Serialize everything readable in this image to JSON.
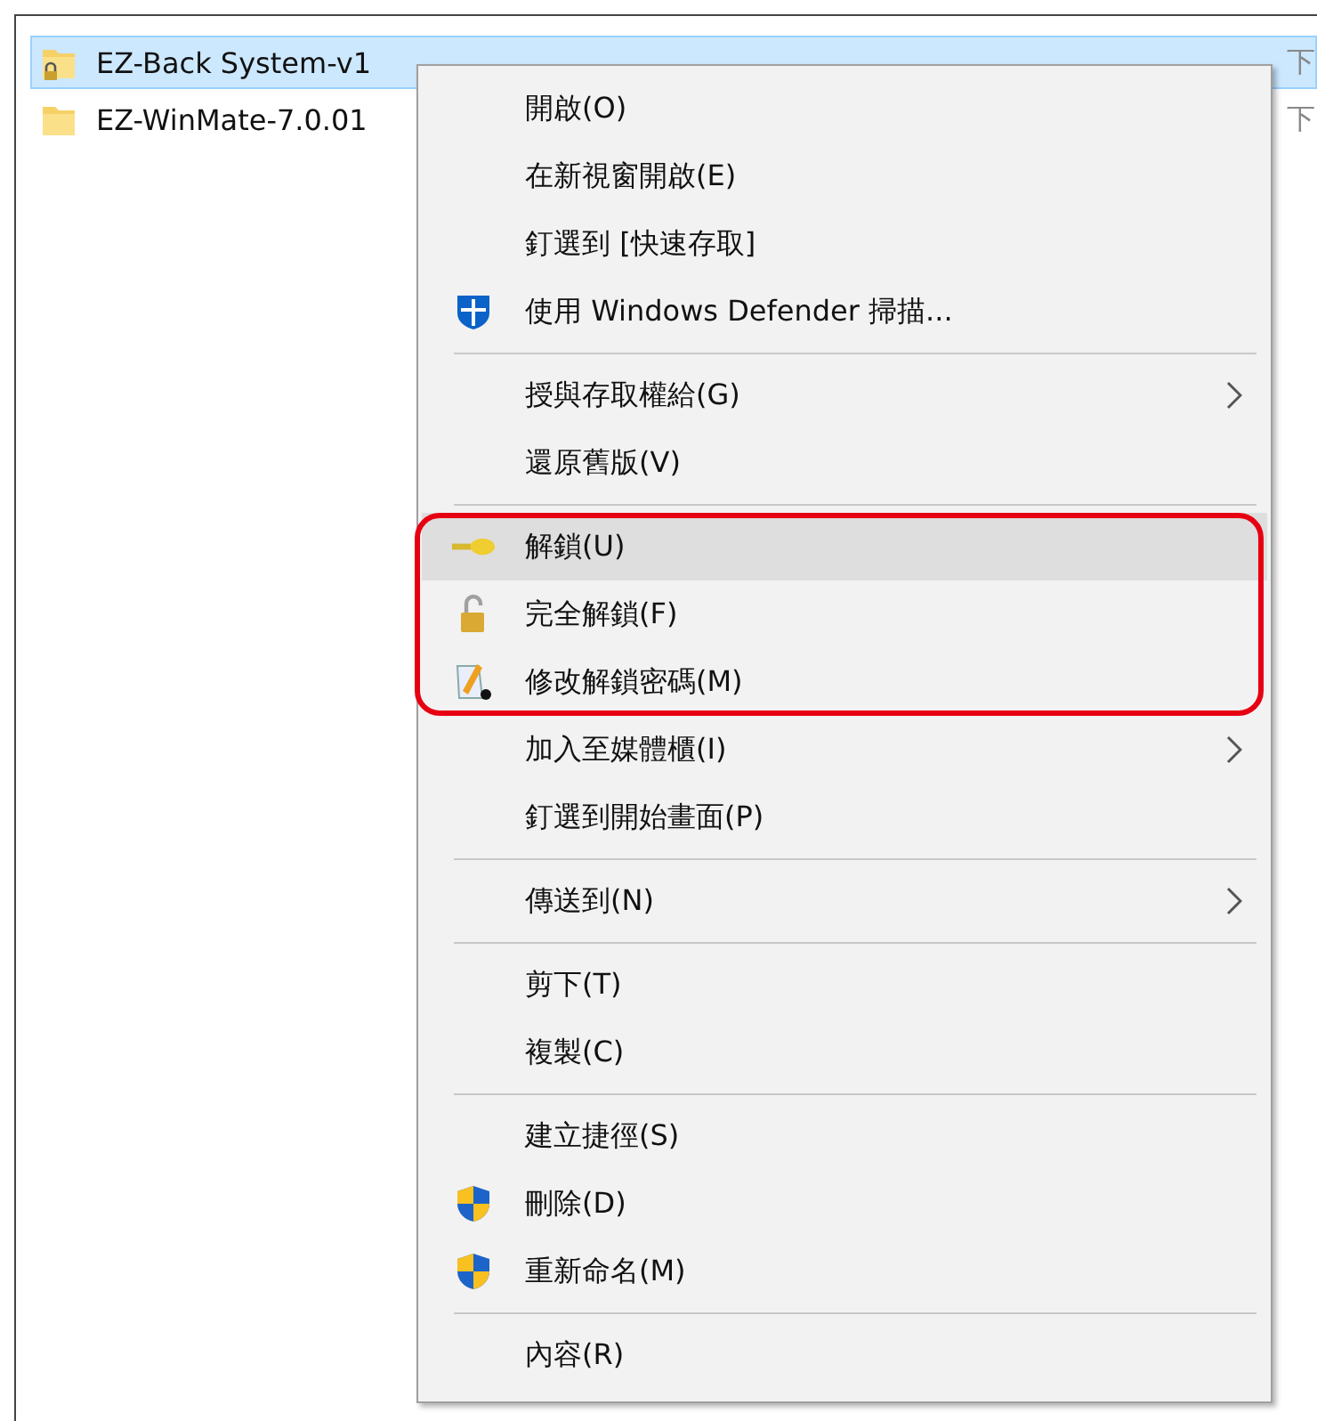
{
  "files": [
    {
      "name": "EZ-Back System-v1",
      "type_hint": "下",
      "selected": true,
      "locked": true
    },
    {
      "name": "EZ-WinMate-7.0.01",
      "type_hint": "下",
      "selected": false,
      "locked": false
    }
  ],
  "context_menu": {
    "sections": [
      {
        "items": [
          {
            "label": "開啟(O)",
            "kind": "plain",
            "selected": false,
            "submenu": false,
            "outlined": false
          },
          {
            "label": "在新視窗開啟(E)",
            "kind": "plain",
            "selected": false,
            "submenu": false,
            "outlined": false
          },
          {
            "label": "釘選到 [快速存取]",
            "kind": "plain",
            "selected": false,
            "submenu": false,
            "outlined": false
          },
          {
            "label": "使用 Windows Defender 掃描...",
            "kind": "defender",
            "selected": false,
            "submenu": false,
            "outlined": false
          }
        ]
      },
      {
        "items": [
          {
            "label": "授與存取權給(G)",
            "kind": "plain",
            "selected": false,
            "submenu": true,
            "outlined": false
          },
          {
            "label": "還原舊版(V)",
            "kind": "plain",
            "selected": false,
            "submenu": false,
            "outlined": false
          }
        ]
      },
      {
        "items": [
          {
            "label": "解鎖(U)",
            "kind": "key",
            "selected": true,
            "submenu": false,
            "outlined": true
          },
          {
            "label": "完全解鎖(F)",
            "kind": "padlock",
            "selected": false,
            "submenu": false,
            "outlined": true
          },
          {
            "label": "修改解鎖密碼(M)",
            "kind": "pen",
            "selected": false,
            "submenu": false,
            "outlined": true
          },
          {
            "label": "加入至媒體櫃(I)",
            "kind": "plain",
            "selected": false,
            "submenu": true,
            "outlined": false
          },
          {
            "label": "釘選到開始畫面(P)",
            "kind": "plain",
            "selected": false,
            "submenu": false,
            "outlined": false
          }
        ]
      },
      {
        "items": [
          {
            "label": "傳送到(N)",
            "kind": "plain",
            "selected": false,
            "submenu": true,
            "outlined": false
          }
        ]
      },
      {
        "items": [
          {
            "label": "剪下(T)",
            "kind": "plain",
            "selected": false,
            "submenu": false,
            "outlined": false
          },
          {
            "label": "複製(C)",
            "kind": "plain",
            "selected": false,
            "submenu": false,
            "outlined": false
          }
        ]
      },
      {
        "items": [
          {
            "label": "建立捷徑(S)",
            "kind": "plain",
            "selected": false,
            "submenu": false,
            "outlined": false
          },
          {
            "label": "刪除(D)",
            "kind": "shield",
            "selected": false,
            "submenu": false,
            "outlined": false
          },
          {
            "label": "重新命名(M)",
            "kind": "shield",
            "selected": false,
            "submenu": false,
            "outlined": false
          }
        ]
      },
      {
        "items": [
          {
            "label": "內容(R)",
            "kind": "plain",
            "selected": false,
            "submenu": false,
            "outlined": false
          }
        ]
      }
    ]
  }
}
